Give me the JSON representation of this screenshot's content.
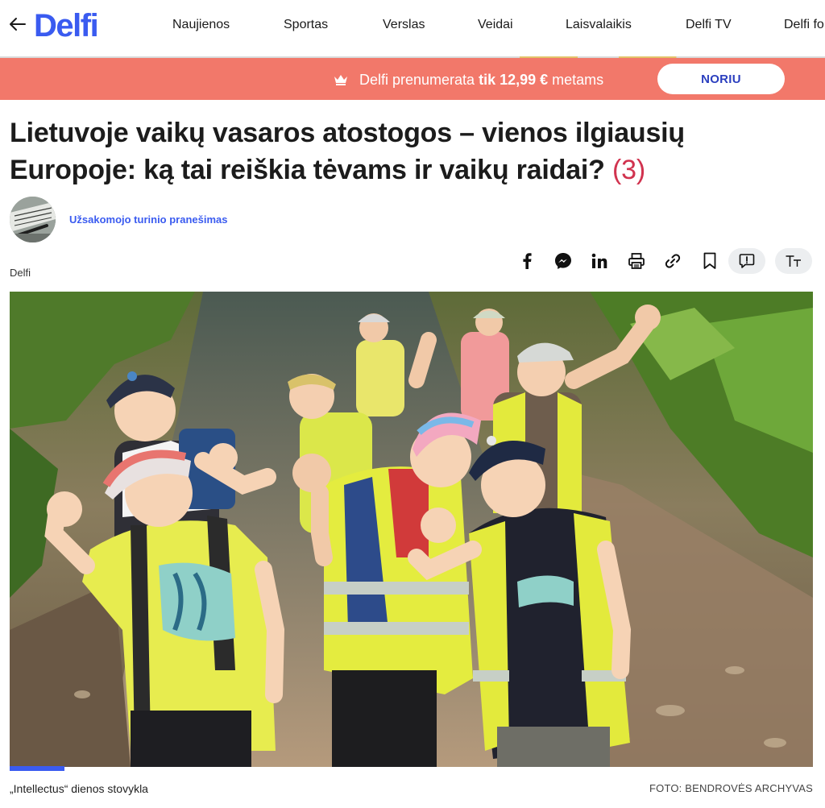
{
  "header": {
    "logo": "Delfi",
    "nav": [
      "Naujienos",
      "Sportas",
      "Verslas",
      "Veidai",
      "Laisvalaikis",
      "Delfi TV",
      "Delfi fo"
    ]
  },
  "promo": {
    "text_prefix": "Delfi prenumerata ",
    "text_bold": "tik 12,99 €",
    "text_suffix": " metams",
    "button_label": "NORIU"
  },
  "article": {
    "title": "Lietuvoje vaikų vasaros atostogos – vienos ilgiausių Europoje: ką tai reiškia tėvams ir vaikų raidai?",
    "comment_count": "(3)",
    "author": "Užsakomojo turinio pranešimas",
    "source": "Delfi",
    "share_icons": [
      "facebook-icon",
      "messenger-icon",
      "linkedin-icon",
      "print-icon",
      "link-icon",
      "bookmark-icon",
      "comment-icon",
      "text-size-icon"
    ],
    "image": {
      "caption": "„Intellectus“ dienos stovykla",
      "credit": "FOTO: BENDROVĖS ARCHYVAS",
      "gallery_progress": 0.07
    }
  },
  "colors": {
    "brand": "#3a5bf0",
    "promo_bg": "#f2786a",
    "comment_count": "#d1334f"
  }
}
